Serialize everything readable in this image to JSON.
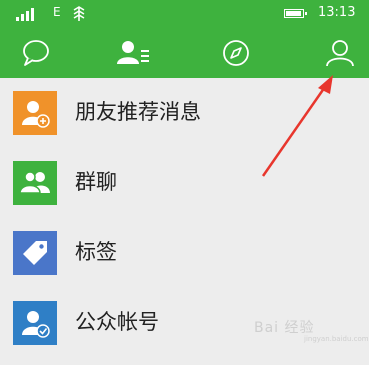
{
  "status_bar": {
    "network": "E",
    "time": "13:13",
    "icons": [
      "signal-icon",
      "data-icon",
      "battery-icon"
    ]
  },
  "tabs": [
    {
      "icon": "chat-icon"
    },
    {
      "icon": "contacts-icon"
    },
    {
      "icon": "discover-icon"
    },
    {
      "icon": "me-icon"
    }
  ],
  "list": [
    {
      "label": "朋友推荐消息",
      "icon": "friend-recommend-icon",
      "color": "#f0922a"
    },
    {
      "label": "群聊",
      "icon": "group-chat-icon",
      "color": "#3eb23e"
    },
    {
      "label": "标签",
      "icon": "tag-icon",
      "color": "#4a76c9"
    },
    {
      "label": "公众帐号",
      "icon": "official-account-icon",
      "color": "#2f7fc6"
    }
  ],
  "colors": {
    "brand": "#3eb23e",
    "background": "#ededed",
    "annotation": "#e8362d"
  },
  "watermark": {
    "text": "Bai 经验",
    "sub": "jingyan.baidu.com"
  }
}
